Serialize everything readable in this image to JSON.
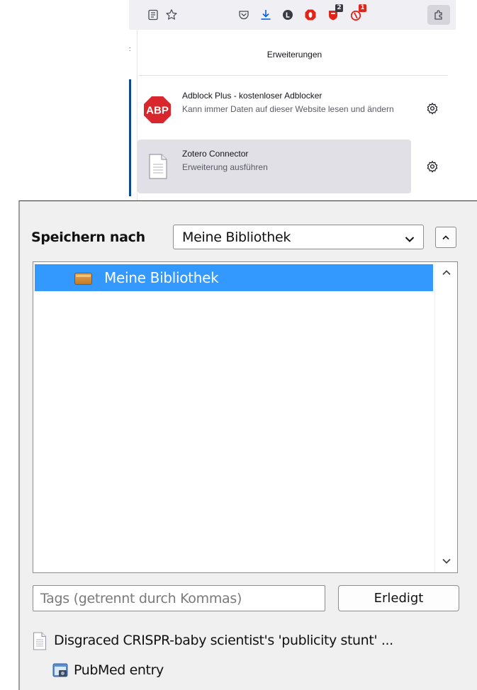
{
  "toolbar": {
    "icons": [
      {
        "name": "reader-view-icon"
      },
      {
        "name": "bookmark-star-icon"
      },
      {
        "name": "pocket-icon"
      },
      {
        "name": "downloads-icon",
        "color": "#0061e0"
      },
      {
        "name": "dark-l-extension-icon"
      },
      {
        "name": "red-o-extension-icon",
        "color": "#e1251b"
      },
      {
        "name": "shield-extension-icon",
        "color": "#e1251b",
        "badge": "2"
      },
      {
        "name": "red-extension-icon",
        "color": "#e1251b",
        "badge": "1"
      },
      {
        "name": "extensions-puzzle-icon"
      }
    ]
  },
  "extensions_panel": {
    "title": "Erweiterungen",
    "items": [
      {
        "icon": "adblock-plus-icon",
        "icon_text": "ABP",
        "name": "Adblock Plus - kostenloser Adblocker",
        "description": "Kann immer Daten auf dieser Website lesen und ändern",
        "settings_icon": "gear-icon"
      },
      {
        "icon": "document-icon",
        "name": "Zotero Connector",
        "description": "Erweiterung ausführen",
        "settings_icon": "gear-icon"
      }
    ]
  },
  "zotero": {
    "save_label": "Speichern nach",
    "selected_library": "Meine Bibliothek",
    "tree_items": [
      {
        "label": "Meine Bibliothek",
        "icon": "library-folder-icon",
        "selected": true
      }
    ],
    "tags_placeholder": "Tags (getrennt durch Kommas)",
    "done_label": "Erledigt",
    "saved_items": [
      {
        "icon": "document-icon",
        "title": "Disgraced CRISPR-baby scientist's 'publicity stunt' ..."
      },
      {
        "icon": "webpage-snapshot-icon",
        "title": "PubMed entry"
      }
    ]
  },
  "colors": {
    "selection": "#3399ff",
    "toolbar_bg": "#f0f0f4",
    "abp_red": "#d9262d"
  }
}
